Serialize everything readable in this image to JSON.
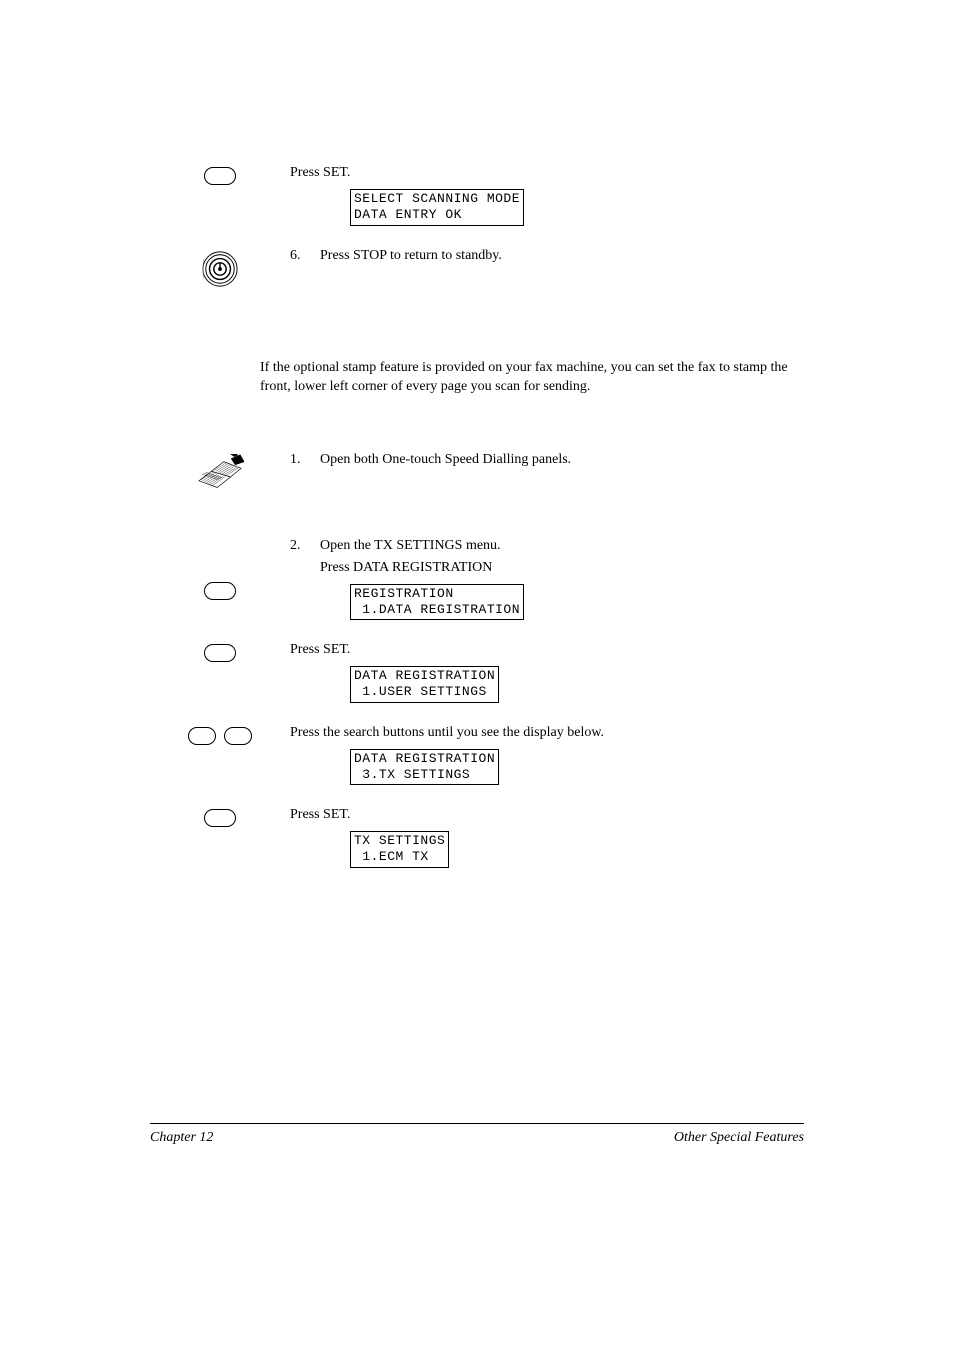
{
  "step_a": {
    "press": "Press SET.",
    "display": "SELECT SCANNING MODE\nDATA ENTRY OK"
  },
  "step6": {
    "num": "6.",
    "text": "Press STOP to return to standby."
  },
  "intro": "If the optional stamp feature is provided on your fax machine, you can set the fax to stamp the front, lower left corner of every page you scan for sending.",
  "step1": {
    "num": "1.",
    "text": "Open both One-touch Speed Dialling panels."
  },
  "step2": {
    "num": "2.",
    "text": "Open the TX SETTINGS menu.",
    "sub1": "Press DATA REGISTRATION",
    "display1": "REGISTRATION\n 1.DATA REGISTRATION",
    "press2": "Press SET.",
    "display2": "DATA REGISTRATION\n 1.USER SETTINGS",
    "press3": "Press the search buttons until you see the display below.",
    "display3": "DATA REGISTRATION\n 3.TX SETTINGS",
    "press4": "Press SET.",
    "display4": "TX SETTINGS\n 1.ECM TX"
  },
  "footer": {
    "left": "Chapter 12",
    "right": "Other Special Features"
  }
}
